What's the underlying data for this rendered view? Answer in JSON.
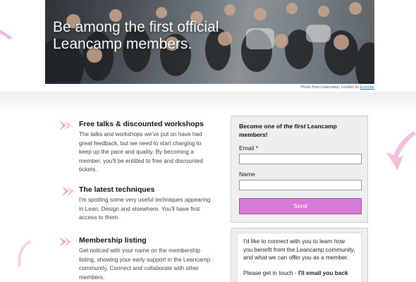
{
  "hero": {
    "title": "Be among the first official Leancamp members.",
    "credit_text": "Photo from Leancamp, London by ",
    "credit_link": "Ezombe"
  },
  "features": [
    {
      "title": "Free talks & discounted workshops",
      "body": "The talks and workshops we've put on have had great feedback, but we need to start charging to keep up the pace and quality. By becoming a member, you'll be entitled to free and discounted tickets."
    },
    {
      "title": "The latest techniques",
      "body": "I'm spotting some very useful techniques appearing in Lean, Design and elsewhere. You'll have first access to them."
    },
    {
      "title": "Membership listing",
      "body": "Get noticed with your name on the membership listing, showing your early support in the Leancamp community. Connect and collaborate with other members."
    }
  ],
  "signup": {
    "heading_pre": "Become one of ",
    "heading_em": "the first",
    "heading_post": " Leancamp members!",
    "email_label": "Email *",
    "name_label": "Name",
    "send_label": "Send"
  },
  "connect": {
    "text": "I'd like to connect with you to learn how you benefit from the Leancamp community, and what we can offer you as a member.",
    "cta_pre": "Please get in touch - ",
    "cta_bold": "I'll email you back"
  },
  "colors": {
    "accent_pink": "#d77ad6",
    "arrow_pink": "#e9a6cf"
  }
}
